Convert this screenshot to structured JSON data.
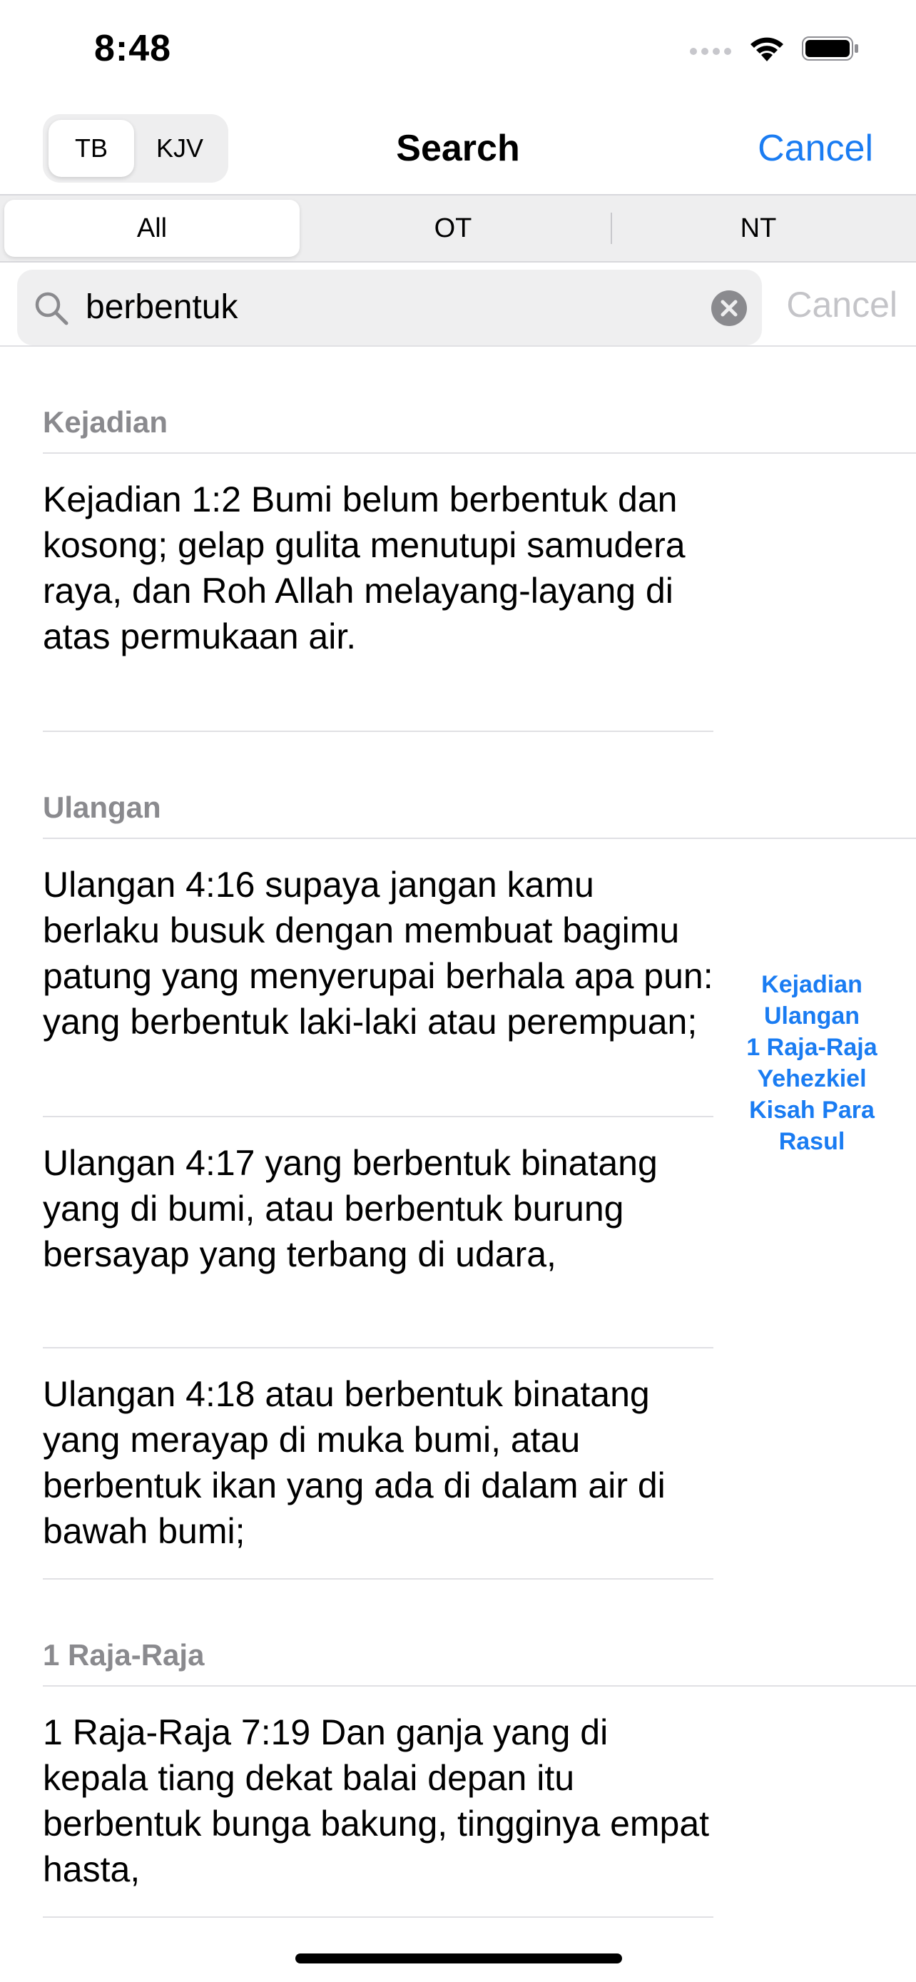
{
  "status_bar": {
    "time": "8:48"
  },
  "nav": {
    "versions": [
      "TB",
      "KJV"
    ],
    "title": "Search",
    "cancel_label": "Cancel"
  },
  "scope": {
    "options": [
      "All",
      "OT",
      "NT"
    ],
    "selected": "All"
  },
  "search": {
    "query": "berbentuk",
    "cancel_label": "Cancel"
  },
  "sections": [
    {
      "header": "Kejadian",
      "results": [
        "Kejadian 1:2 Bumi belum berbentuk dan kosong; gelap gulita menutupi samudera raya, dan Roh Allah melayang-layang di atas permukaan air."
      ]
    },
    {
      "header": "Ulangan",
      "results": [
        "Ulangan 4:16 supaya jangan kamu berlaku busuk dengan membuat bagimu patung yang menyerupai berhala apa pun: yang berbentuk laki-laki atau perempuan;",
        "Ulangan 4:17 yang berbentuk binatang yang di bumi, atau berbentuk burung bersayap yang terbang di udara,",
        "Ulangan 4:18 atau berbentuk binatang yang merayap di muka bumi, atau berbentuk ikan yang ada di dalam air di bawah bumi;"
      ]
    },
    {
      "header": "1 Raja-Raja",
      "results": [
        "1 Raja-Raja 7:19 Dan ganja yang di kepala tiang dekat balai depan itu berbentuk bunga bakung, tingginya empat hasta,"
      ]
    }
  ],
  "section_index": [
    "Kejadian",
    "Ulangan",
    "1 Raja-Raja",
    "Yehezkiel",
    "Kisah Para Rasul"
  ],
  "colors": {
    "accent": "#1a7cf2",
    "section_header": "#8a8a8e",
    "placeholder_gray": "#c4c4c8"
  }
}
